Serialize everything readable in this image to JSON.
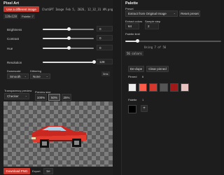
{
  "left": {
    "title": "Pixel Art",
    "use_image_btn": "Use a different image",
    "filename": "ChatGPT Image Feb 5, 2026, 12_32_31 AM.png",
    "dims": "128x128",
    "palette_chip": "Palette: 7",
    "sliders": [
      {
        "label": "Brightness",
        "value": "0",
        "fraction": 0.5
      },
      {
        "label": "Contrast",
        "value": "0",
        "fraction": 0.5
      },
      {
        "label": "Hue",
        "value": "0",
        "fraction": 0.5
      }
    ],
    "resolution": {
      "label": "Resolution",
      "value": "128",
      "fraction": 1.0
    },
    "downscale": {
      "label": "Downscale",
      "value": "Smooth"
    },
    "dithering": {
      "label": "Dithering",
      "value": "None"
    },
    "timing": "3ms",
    "transparency": {
      "label": "Transparency preview",
      "value": "Checker"
    },
    "preview_size": {
      "label": "Preview size",
      "options": [
        "100%",
        "50%",
        "25%"
      ],
      "active": "50%"
    },
    "download_btn": "Download PNG",
    "export": {
      "label": "Export",
      "value": "1x"
    }
  },
  "palette": {
    "title": "Palette",
    "preset_label": "Preset",
    "preset_value": "Extract from Original Image",
    "reset_btn": "Reset preset",
    "extract_colors_label": "Extract colors",
    "extract_colors_value": "64",
    "sample_step_label": "Sample step",
    "sample_step_value": "2",
    "palette_limit_label": "Palette limit",
    "using_text": "Using 7 of 56",
    "colors_chip": "56 colors",
    "dedupe_btn": "De-dupe",
    "clear_pinned_btn": "Clear pinned",
    "pinned_label": "Pinned",
    "pinned_count": "6",
    "swatches": [
      "#eeeeee",
      "#ff5a4a",
      "#d4382d",
      "#555555",
      "#a01818",
      "#e8c2bf"
    ],
    "palette_label": "Palette",
    "palette_count": "1",
    "palette_swatches": [
      "#000000"
    ],
    "add_symbol": "+"
  }
}
